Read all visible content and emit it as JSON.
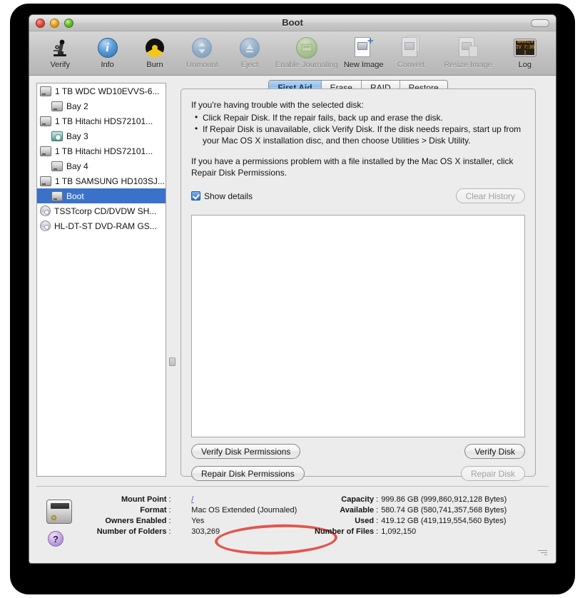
{
  "window": {
    "title": "Boot",
    "traffic_lights": [
      "close-button",
      "minimize-button",
      "zoom-button"
    ]
  },
  "toolbar": {
    "items": [
      {
        "label": "Verify",
        "icon": "microscope-icon",
        "enabled": true
      },
      {
        "label": "Info",
        "icon": "info-icon",
        "enabled": true
      },
      {
        "label": "Burn",
        "icon": "burn-icon",
        "enabled": true
      },
      {
        "label": "Unmount",
        "icon": "unmount-icon",
        "enabled": false
      },
      {
        "label": "Eject",
        "icon": "eject-icon",
        "enabled": false
      },
      {
        "label": "Enable Journaling",
        "icon": "journaling-icon",
        "enabled": false
      },
      {
        "label": "New Image",
        "icon": "new-image-icon",
        "enabled": true
      },
      {
        "label": "Convert",
        "icon": "convert-icon",
        "enabled": false
      },
      {
        "label": "Resize Image",
        "icon": "resize-image-icon",
        "enabled": false
      }
    ],
    "log": {
      "label": "Log",
      "icon": "log-icon",
      "line1": "WARNIN",
      "line2": "IV 7:36 I"
    }
  },
  "sidebar": {
    "items": [
      {
        "label": "1 TB WDC WD10EVVS-6...",
        "icon": "hard-disk-icon",
        "indent": false,
        "selected": false
      },
      {
        "label": "Bay 2",
        "icon": "volume-icon",
        "indent": true,
        "selected": false
      },
      {
        "label": "1 TB Hitachi HDS72101...",
        "icon": "hard-disk-icon",
        "indent": false,
        "selected": false
      },
      {
        "label": "Bay 3",
        "icon": "green-volume-icon",
        "indent": true,
        "selected": false
      },
      {
        "label": "1 TB Hitachi HDS72101...",
        "icon": "hard-disk-icon",
        "indent": false,
        "selected": false
      },
      {
        "label": "Bay 4",
        "icon": "volume-icon",
        "indent": true,
        "selected": false
      },
      {
        "label": "1 TB SAMSUNG HD103SJ...",
        "icon": "hard-disk-icon",
        "indent": false,
        "selected": false
      },
      {
        "label": "Boot",
        "icon": "volume-icon",
        "indent": true,
        "selected": true
      },
      {
        "label": "TSSTcorp CD/DVDW SH...",
        "icon": "optical-disc-icon",
        "indent": false,
        "selected": false
      },
      {
        "label": "HL-DT-ST DVD-RAM GS...",
        "icon": "optical-disc-icon",
        "indent": false,
        "selected": false
      }
    ]
  },
  "tabs": [
    {
      "label": "First Aid",
      "active": true
    },
    {
      "label": "Erase",
      "active": false
    },
    {
      "label": "RAID",
      "active": false
    },
    {
      "label": "Restore",
      "active": false
    }
  ],
  "first_aid": {
    "intro": "If you're having trouble with the selected disk:",
    "bullets": [
      "Click Repair Disk. If the repair fails, back up and erase the disk.",
      "If Repair Disk is unavailable, click Verify Disk. If the disk needs repairs, start up from your Mac OS X installation disc, and then choose Utilities > Disk Utility."
    ],
    "paragraph": "If you have a permissions problem with a file installed by the Mac OS X installer, click Repair Disk Permissions.",
    "show_details_label": "Show details",
    "show_details_checked": true,
    "clear_history_label": "Clear History",
    "clear_history_enabled": false,
    "log_text": "",
    "buttons": {
      "verify_disk_permissions": {
        "label": "Verify Disk Permissions",
        "enabled": true
      },
      "repair_disk_permissions": {
        "label": "Repair Disk Permissions",
        "enabled": true,
        "annotated": true
      },
      "verify_disk": {
        "label": "Verify Disk",
        "enabled": true
      },
      "repair_disk": {
        "label": "Repair Disk",
        "enabled": false
      }
    }
  },
  "annotation": {
    "shape": "ellipse",
    "color": "#e2564f",
    "target": "Repair Disk Permissions"
  },
  "info": {
    "left": [
      {
        "label": "Mount Point",
        "value": "/",
        "link": true
      },
      {
        "label": "Format",
        "value": "Mac OS Extended (Journaled)",
        "link": false
      },
      {
        "label": "Owners Enabled",
        "value": "Yes",
        "link": false
      },
      {
        "label": "Number of Folders",
        "value": "303,269",
        "link": false
      }
    ],
    "right": [
      {
        "label": "Capacity",
        "value": "999.86 GB (999,860,912,128 Bytes)"
      },
      {
        "label": "Available",
        "value": "580.74 GB (580,741,357,568 Bytes)"
      },
      {
        "label": "Used",
        "value": "419.12 GB (419,119,554,560 Bytes)"
      },
      {
        "label": "Number of Files",
        "value": "1,092,150"
      }
    ],
    "help_label": "?"
  },
  "colors": {
    "selection_blue": "#3b72c9",
    "annotation_red": "#e2564f",
    "window_bg": "#ececec"
  }
}
